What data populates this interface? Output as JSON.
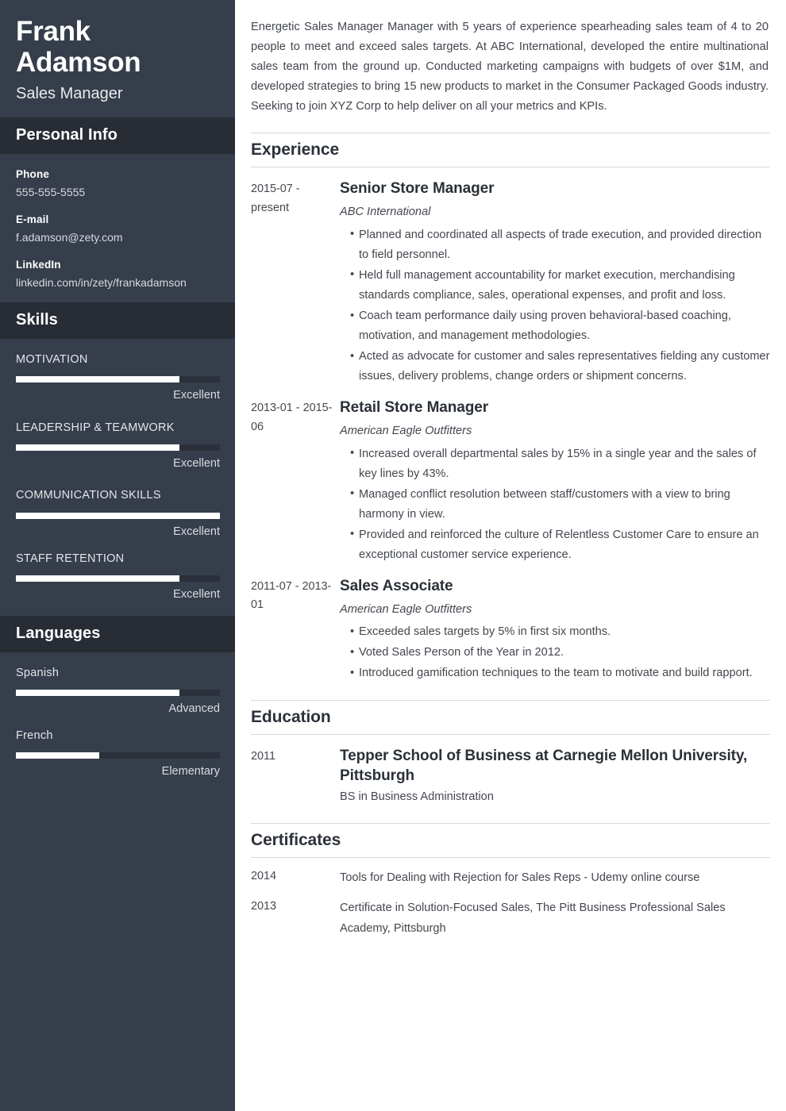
{
  "sidebar": {
    "name": "Frank Adamson",
    "job_title": "Sales Manager",
    "personal_info": {
      "heading": "Personal Info",
      "fields": [
        {
          "label": "Phone",
          "value": "555-555-5555"
        },
        {
          "label": "E-mail",
          "value": "f.adamson@zety.com"
        },
        {
          "label": "LinkedIn",
          "value": "linkedin.com/in/zety/frankadamson"
        }
      ]
    },
    "skills": {
      "heading": "Skills",
      "items": [
        {
          "name": "MOTIVATION",
          "level_label": "Excellent",
          "percent": 80
        },
        {
          "name": "LEADERSHIP & TEAMWORK",
          "level_label": "Excellent",
          "percent": 80
        },
        {
          "name": "COMMUNICATION SKILLS",
          "level_label": "Excellent",
          "percent": 100
        },
        {
          "name": "STAFF RETENTION",
          "level_label": "Excellent",
          "percent": 80
        }
      ]
    },
    "languages": {
      "heading": "Languages",
      "items": [
        {
          "name": "Spanish",
          "level_label": "Advanced",
          "percent": 80
        },
        {
          "name": "French",
          "level_label": "Elementary",
          "percent": 41
        }
      ]
    }
  },
  "main": {
    "summary": "Energetic Sales Manager Manager with 5 years of experience spearheading sales team of 4 to 20 people to meet and exceed sales targets. At ABC International, developed the entire multinational sales team from the ground up. Conducted marketing campaigns with budgets of over $1M, and developed strategies to bring 15 new products to market in the Consumer Packaged Goods industry. Seeking to join XYZ Corp to help deliver on all your metrics and KPIs.",
    "experience": {
      "heading": "Experience",
      "entries": [
        {
          "date": "2015-07 - present",
          "title": "Senior Store Manager",
          "company": "ABC International",
          "bullets": [
            "Planned and coordinated all aspects of trade execution, and provided direction to field personnel.",
            "Held full management accountability for market execution, merchandising standards compliance, sales, operational expenses, and profit and loss.",
            "Coach team performance daily using proven behavioral-based coaching, motivation, and management methodologies.",
            "Acted as advocate for customer and sales representatives fielding any customer issues, delivery problems, change orders or shipment concerns."
          ]
        },
        {
          "date": "2013-01 - 2015-06",
          "title": "Retail Store Manager",
          "company": "American Eagle Outfitters",
          "bullets": [
            "Increased overall departmental sales by 15% in a single year and the sales of key lines by 43%.",
            "Managed conflict resolution between staff/customers with a view to bring harmony in view.",
            "Provided and reinforced the culture of Relentless Customer Care to ensure an exceptional customer service experience."
          ]
        },
        {
          "date": "2011-07 - 2013-01",
          "title": "Sales Associate",
          "company": "American Eagle Outfitters",
          "bullets": [
            "Exceeded sales targets by 5% in first six months.",
            "Voted Sales Person of the Year in 2012.",
            "Introduced gamification techniques to the team to motivate and build rapport."
          ]
        }
      ]
    },
    "education": {
      "heading": "Education",
      "entries": [
        {
          "date": "2011",
          "title": "Tepper School of Business at Carnegie Mellon University, Pittsburgh",
          "degree": "BS in Business Administration"
        }
      ]
    },
    "certificates": {
      "heading": "Certificates",
      "entries": [
        {
          "date": "2014",
          "text": "Tools for Dealing with Rejection for Sales Reps - Udemy online course"
        },
        {
          "date": "2013",
          "text": "Certificate in Solution-Focused Sales, The Pitt Business Professional Sales Academy, Pittsburgh"
        }
      ]
    }
  }
}
